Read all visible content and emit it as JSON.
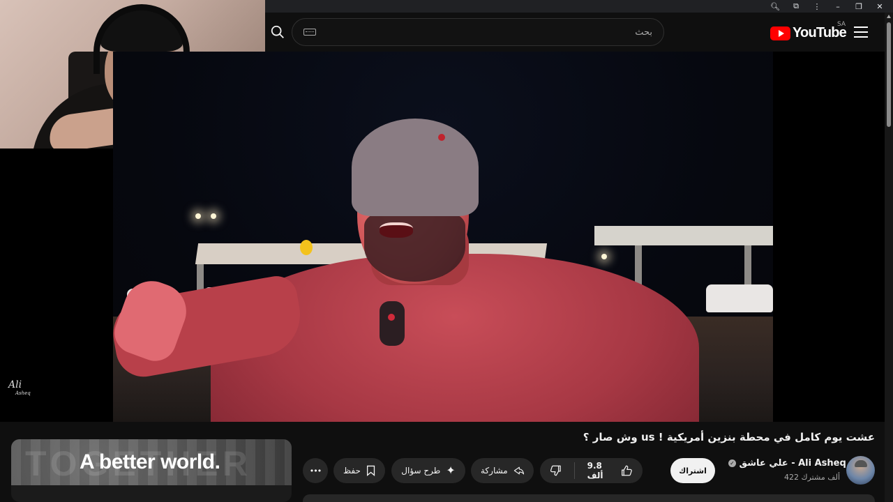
{
  "header": {
    "search_placeholder": "بحث",
    "logo_text": "YouTube",
    "country_code": "SA"
  },
  "chrome": {
    "buttons": [
      "search-icon",
      "extensions-icon",
      "menu-kebab-icon",
      "minimize-icon",
      "restore-icon",
      "close-icon"
    ]
  },
  "video": {
    "title": "عشت يوم كامل في محطة بنزين أمريكية ! us وش صار ؟"
  },
  "channel": {
    "name": "علي عاشق - Ali Asheq",
    "verified": true,
    "subscribers": "422 ألف مشترك",
    "subscribe_label": "اشتراك"
  },
  "actions": {
    "likes": "9.8 ألف",
    "share_label": "مشاركة",
    "ask_label": "طرح سؤال",
    "save_label": "حفظ",
    "more_label": "•••"
  },
  "ad": {
    "text": "A better world.",
    "background_word": "TOGETHER"
  },
  "overlay": {
    "signature": "Ali",
    "signature_sub": "Asheq"
  },
  "colors": {
    "brand_red": "#ff0000",
    "background": "#0f0f0f",
    "pill": "#272727",
    "subscribe_bg": "#f1f1f1"
  }
}
